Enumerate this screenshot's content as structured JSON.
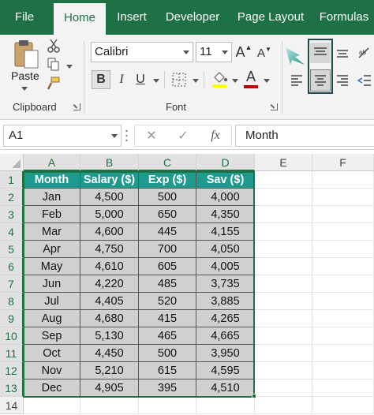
{
  "ribbon": {
    "tabs": [
      {
        "label": "File",
        "active": false
      },
      {
        "label": "Home",
        "active": true
      },
      {
        "label": "Insert",
        "active": false
      },
      {
        "label": "Developer",
        "active": false
      },
      {
        "label": "Page Layout",
        "active": false
      },
      {
        "label": "Formulas",
        "active": false
      }
    ],
    "clipboard": {
      "paste_label": "Paste",
      "group_label": "Clipboard"
    },
    "font": {
      "font_name": "Calibri",
      "font_size": "11",
      "group_label": "Font",
      "bold": "B",
      "italic": "I",
      "underline": "U",
      "grow": "A",
      "shrink": "A",
      "font_color": "A"
    }
  },
  "formula_bar": {
    "name_box": "A1",
    "fx": "fx",
    "cancel": "✕",
    "enter": "✓",
    "value": "Month"
  },
  "grid": {
    "columns": [
      "A",
      "B",
      "C",
      "D",
      "E",
      "F"
    ],
    "row_numbers": [
      "1",
      "2",
      "3",
      "4",
      "5",
      "6",
      "7",
      "8",
      "9",
      "10",
      "11",
      "12",
      "13",
      "14"
    ],
    "header": [
      "Month",
      "Salary ($)",
      "Exp ($)",
      "Sav ($)"
    ],
    "rows": [
      [
        "Jan",
        "4,500",
        "500",
        "4,000"
      ],
      [
        "Feb",
        "5,000",
        "650",
        "4,350"
      ],
      [
        "Mar",
        "4,600",
        "445",
        "4,155"
      ],
      [
        "Apr",
        "4,750",
        "700",
        "4,050"
      ],
      [
        "May",
        "4,610",
        "605",
        "4,005"
      ],
      [
        "Jun",
        "4,220",
        "485",
        "3,735"
      ],
      [
        "Jul",
        "4,405",
        "520",
        "3,885"
      ],
      [
        "Aug",
        "4,680",
        "415",
        "4,265"
      ],
      [
        "Sep",
        "5,130",
        "465",
        "4,665"
      ],
      [
        "Oct",
        "4,450",
        "500",
        "3,950"
      ],
      [
        "Nov",
        "5,210",
        "615",
        "4,595"
      ],
      [
        "Dec",
        "4,905",
        "395",
        "4,510"
      ]
    ]
  },
  "colors": {
    "ribbon_green": "#1e7145",
    "header_fill": "#1f9a8f",
    "data_fill": "#d0d0d0"
  }
}
